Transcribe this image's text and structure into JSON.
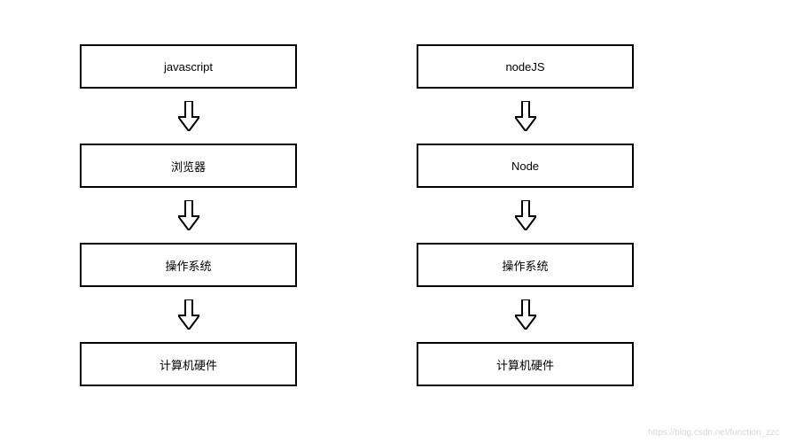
{
  "diagram": {
    "left_column": {
      "box1": "javascript",
      "box2": "浏览器",
      "box3": "操作系统",
      "box4": "计算机硬件"
    },
    "right_column": {
      "box1": "nodeJS",
      "box2": "Node",
      "box3": "操作系统",
      "box4": "计算机硬件"
    }
  },
  "watermark": "https://blog.csdn.net/function_zzc"
}
